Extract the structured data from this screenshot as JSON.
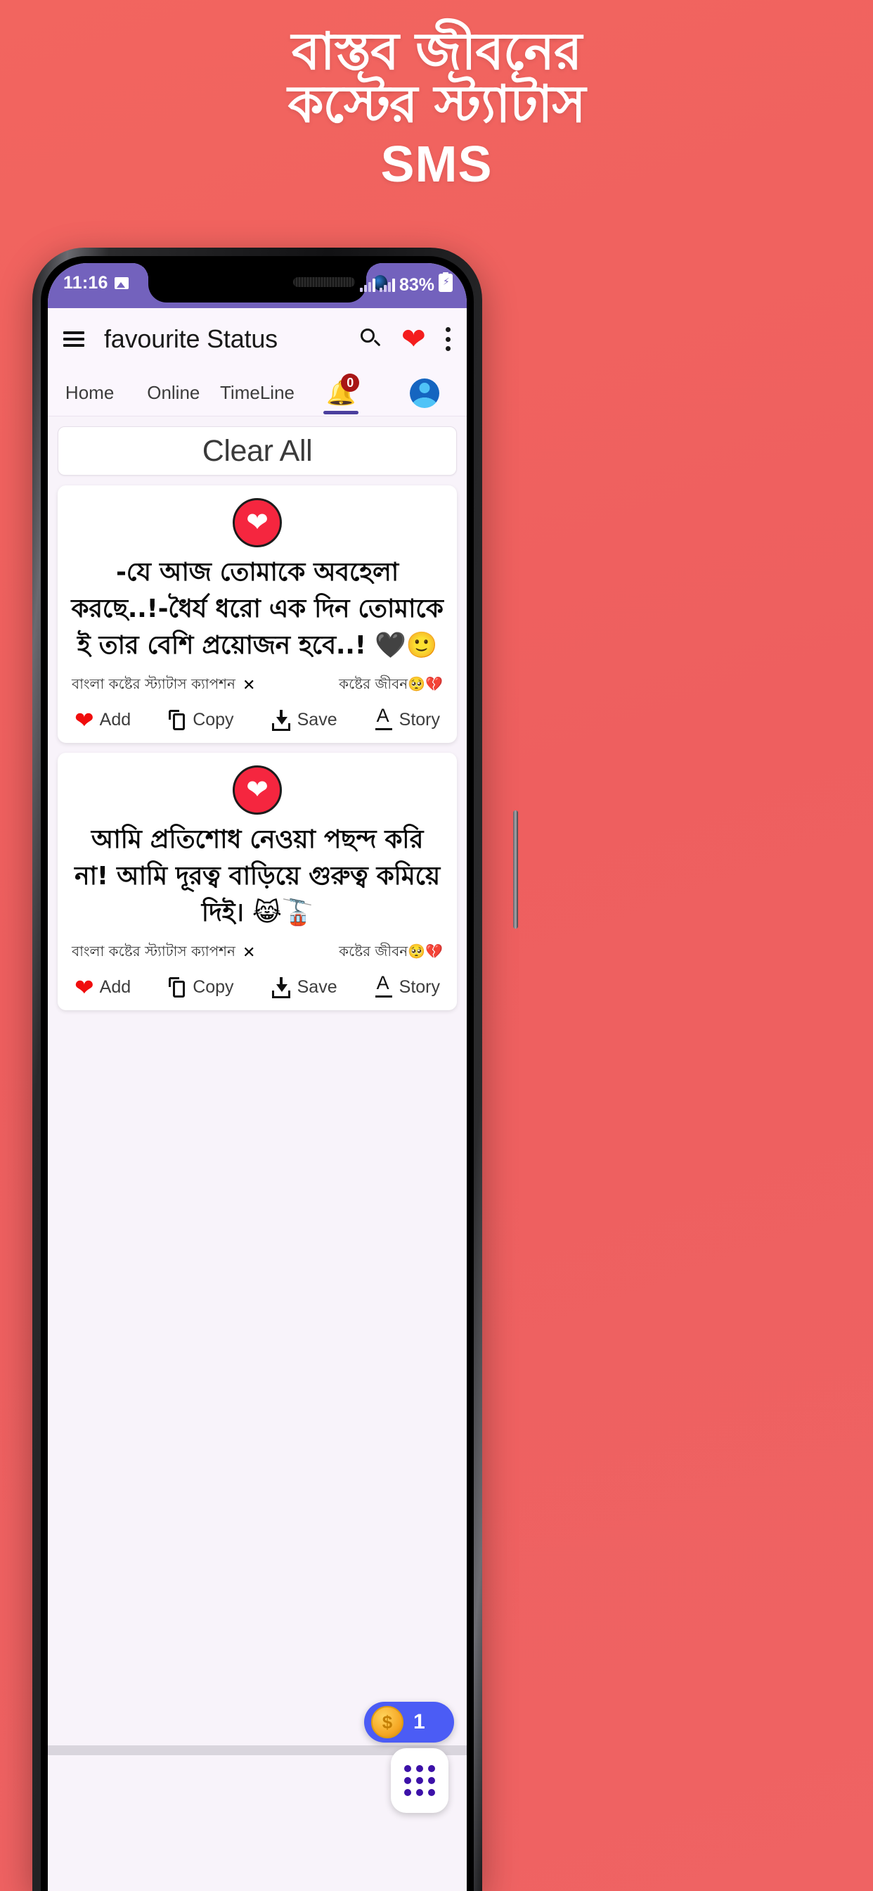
{
  "promo": {
    "line1": "বাস্তব জীবনের",
    "line2": "কস্টের স্ট্যাটাস",
    "line3": "SMS",
    "background_color": "#ef6060",
    "text_color": "#ffffff"
  },
  "status_bar": {
    "time": "11:16",
    "photo_icon": "image-icon",
    "signal_icon": "signal-bars-icon",
    "battery_percent": "83%",
    "battery_icon": "battery-charging-icon",
    "background_color": "#7362bd"
  },
  "app_bar": {
    "menu_icon": "hamburger-menu-icon",
    "title": "favourite Status",
    "search_icon": "search-icon",
    "favourite_icon": "heart-icon",
    "overflow_icon": "kebab-menu-icon",
    "favourite_color": "#f41d1d"
  },
  "tabs": {
    "items": [
      {
        "label": "Home",
        "active": false
      },
      {
        "label": "Online",
        "active": false
      },
      {
        "label": "TimeLine",
        "active": false
      }
    ],
    "notification": {
      "icon": "bell-icon",
      "badge_count": "0",
      "badge_color": "#a81616",
      "active": true
    },
    "profile": {
      "icon": "avatar-icon"
    },
    "active_indicator_color": "#4b3f9e"
  },
  "clear_all": {
    "label": "Clear All"
  },
  "cards": [
    {
      "badge_icon": "heart-in-circle-icon",
      "text": "-যে আজ তোমাকে অবহেলা করছে..!-ধৈর্য ধরো এক দিন তোমাকে ই তার বেশি প্রয়োজন হবে..! 🖤🙂",
      "caption_left": "বাংলা কষ্টের স্ট্যাটাস ক্যাপশন",
      "caption_close": "✕",
      "caption_right": "কষ্টের জীবন🥺💔",
      "actions": [
        {
          "label": "Add",
          "icon": "heart-icon"
        },
        {
          "label": "Copy",
          "icon": "copy-icon"
        },
        {
          "label": "Save",
          "icon": "download-icon"
        },
        {
          "label": "Story",
          "icon": "text-story-icon"
        }
      ]
    },
    {
      "badge_icon": "heart-in-circle-icon",
      "text": "আমি প্রতিশোধ নেওয়া পছন্দ করি না! আমি দূরত্ব বাড়িয়ে গুরুত্ব কমিয়ে দিই। 😹🚡",
      "caption_left": "বাংলা কষ্টের স্ট্যাটাস ক্যাপশন",
      "caption_close": "✕",
      "caption_right": "কষ্টের জীবন🥺💔",
      "actions": [
        {
          "label": "Add",
          "icon": "heart-icon"
        },
        {
          "label": "Copy",
          "icon": "copy-icon"
        },
        {
          "label": "Save",
          "icon": "download-icon"
        },
        {
          "label": "Story",
          "icon": "text-story-icon"
        }
      ]
    }
  ],
  "floating": {
    "coin": {
      "icon": "coin-icon",
      "symbol": "$",
      "count": "1",
      "color": "#4b5cf5"
    },
    "apps_grid": {
      "icon": "grid-dots-icon",
      "dot_color": "#3c11a8"
    }
  }
}
